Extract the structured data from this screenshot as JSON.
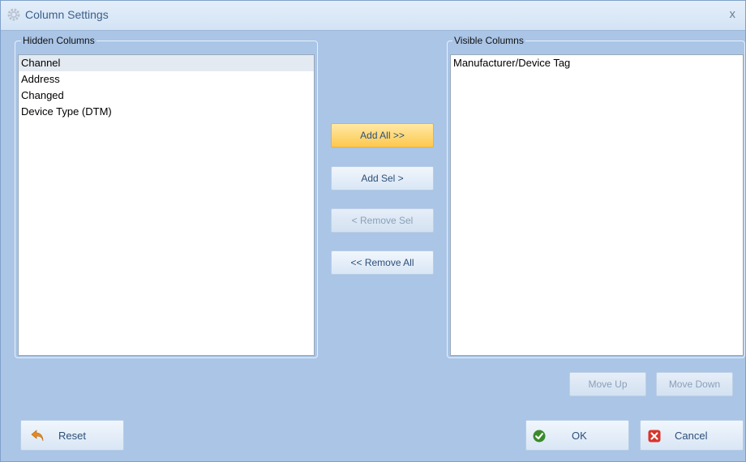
{
  "window": {
    "title": "Column Settings",
    "close_glyph": "x"
  },
  "hidden_columns": {
    "label": "Hidden Columns",
    "items": [
      "Channel",
      "Address",
      "Changed",
      "Device Type (DTM)"
    ]
  },
  "visible_columns": {
    "label": "Visible Columns",
    "items": [
      "Manufacturer/Device Tag"
    ]
  },
  "transfer": {
    "add_all": "Add All >>",
    "add_sel": "Add Sel >",
    "remove_sel": "< Remove Sel",
    "remove_all": "<< Remove All"
  },
  "order": {
    "move_up": "Move Up",
    "move_down": "Move Down"
  },
  "footer": {
    "reset": "Reset",
    "ok": "OK",
    "cancel": "Cancel"
  },
  "colors": {
    "dialog_bg": "#aac5e6",
    "active_button": "#fdc84e",
    "ok_icon": "#3a8a2c",
    "cancel_icon": "#d9342b",
    "reset_icon": "#e48a1e"
  }
}
